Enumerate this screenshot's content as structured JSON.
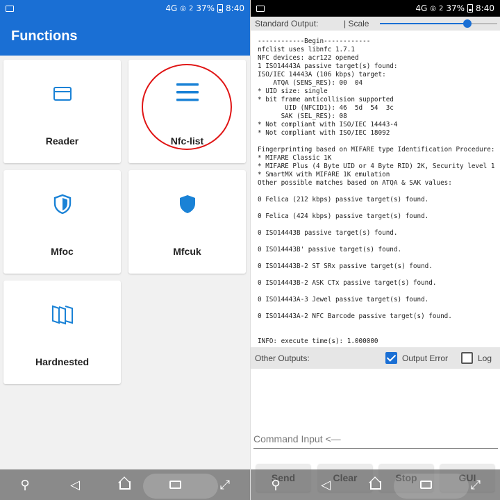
{
  "left_status": {
    "network": "4G",
    "sim_badge": "2",
    "battery": "37%",
    "time": "8:40"
  },
  "right_status": {
    "network": "4G",
    "sim_badge": "2",
    "battery": "37%",
    "time": "8:40"
  },
  "appbar": {
    "title": "Functions"
  },
  "cards": [
    {
      "label": "Reader",
      "icon": "credit-card-icon"
    },
    {
      "label": "Nfc-list",
      "icon": "menu-lines-icon"
    },
    {
      "label": "Mfoc",
      "icon": "shield-outline-icon"
    },
    {
      "label": "Mfcuk",
      "icon": "shield-filled-icon"
    },
    {
      "label": "Hardnested",
      "icon": "stacked-cards-icon"
    }
  ],
  "colors": {
    "primary": "#1a6fd4",
    "highlight": "#e01515",
    "icon": "#1a82d6"
  },
  "output_bar": {
    "label": "Standard Output:",
    "scale_label": "| Scale",
    "scale_value": 0.85
  },
  "console": {
    "lines": [
      "------------Begin------------",
      "nfclist uses libnfc 1.7.1",
      "NFC devices: acr122 opened",
      "1 ISO14443A passive target(s) found:",
      "ISO/IEC 14443A (106 kbps) target:",
      "    ATQA (SENS_RES): 00  04",
      "* UID size: single",
      "* bit frame anticollision supported",
      "       UID (NFCID1): 46  5d  54  3c",
      "      SAK (SEL_RES): 08",
      "* Not compliant with ISO/IEC 14443-4",
      "* Not compliant with ISO/IEC 18092",
      "",
      "Fingerprinting based on MIFARE type Identification Procedure:",
      "* MIFARE Classic 1K",
      "* MIFARE Plus (4 Byte UID or 4 Byte RID) 2K, Security level 1",
      "* SmartMX with MIFARE 1K emulation",
      "Other possible matches based on ATQA & SAK values:",
      "",
      "0 Felica (212 kbps) passive target(s) found.",
      "",
      "0 Felica (424 kbps) passive target(s) found.",
      "",
      "0 ISO14443B passive target(s) found.",
      "",
      "0 ISO14443B' passive target(s) found.",
      "",
      "0 ISO14443B-2 ST SRx passive target(s) found.",
      "",
      "0 ISO14443B-2 ASK CTx passive target(s) found.",
      "",
      "0 ISO14443A-3 Jewel passive target(s) found.",
      "",
      "0 ISO14443A-2 NFC Barcode passive target(s) found.",
      "",
      "",
      "INFO: execute time(s): 1.000000"
    ]
  },
  "other_outputs": {
    "label": "Other Outputs:",
    "output_error_label": "Output Error",
    "output_error_checked": true,
    "log_label": "Log",
    "log_checked": false
  },
  "command_input": {
    "placeholder": "Command Input <—"
  },
  "buttons": {
    "send": "Send",
    "clear": "Clear",
    "stop": "Stop",
    "gui": "GUI"
  }
}
